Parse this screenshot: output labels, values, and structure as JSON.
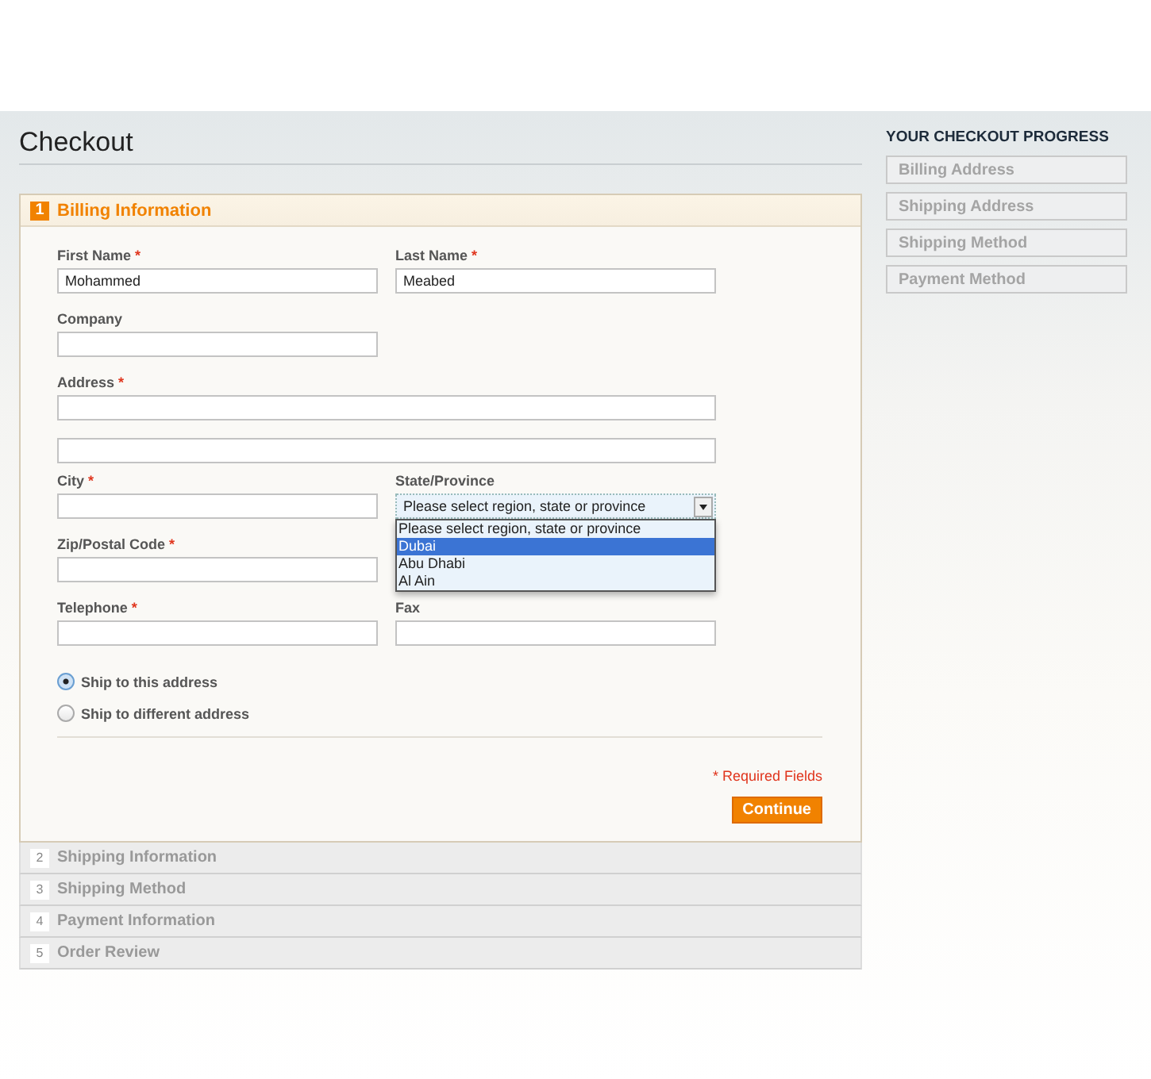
{
  "page": {
    "title": "Checkout"
  },
  "required_marker": "*",
  "steps": [
    {
      "number": "1",
      "title": "Billing Information",
      "active": true
    },
    {
      "number": "2",
      "title": "Shipping Information",
      "active": false
    },
    {
      "number": "3",
      "title": "Shipping Method",
      "active": false
    },
    {
      "number": "4",
      "title": "Payment Information",
      "active": false
    },
    {
      "number": "5",
      "title": "Order Review",
      "active": false
    }
  ],
  "billing_form": {
    "rows": [
      [
        {
          "kind": "text",
          "label": "First Name",
          "required": true,
          "value": "Mohammed"
        },
        {
          "kind": "text",
          "label": "Last Name",
          "required": true,
          "value": "Meabed"
        }
      ],
      [
        {
          "kind": "text",
          "label": "Company",
          "required": false
        }
      ],
      [
        {
          "kind": "wide",
          "label": "Address",
          "required": true
        }
      ],
      [
        {
          "kind": "wide"
        }
      ],
      [
        {
          "kind": "text",
          "label": "City",
          "required": true
        },
        {
          "kind": "select",
          "label": "State/Province",
          "required": false,
          "value": "Please select region, state or province",
          "expanded": true,
          "options": [
            {
              "label": "Please select region, state or province",
              "highlighted": false
            },
            {
              "label": "Dubai",
              "highlighted": true
            },
            {
              "label": "Abu Dhabi",
              "highlighted": false
            },
            {
              "label": "Al Ain",
              "highlighted": false
            }
          ]
        }
      ],
      [
        {
          "kind": "text",
          "label": "Zip/Postal Code",
          "required": true
        }
      ],
      [
        {
          "kind": "text",
          "label": "Telephone",
          "required": true
        },
        {
          "kind": "text",
          "label": "Fax",
          "required": false
        }
      ]
    ],
    "ship_options": [
      {
        "label": "Ship to this address",
        "selected": true
      },
      {
        "label": "Ship to different address",
        "selected": false
      }
    ],
    "required_note": "* Required Fields",
    "button": "Continue"
  },
  "progress": {
    "title": "YOUR CHECKOUT PROGRESS",
    "items": [
      "Billing Address",
      "Shipping Address",
      "Shipping Method",
      "Payment Method"
    ]
  }
}
